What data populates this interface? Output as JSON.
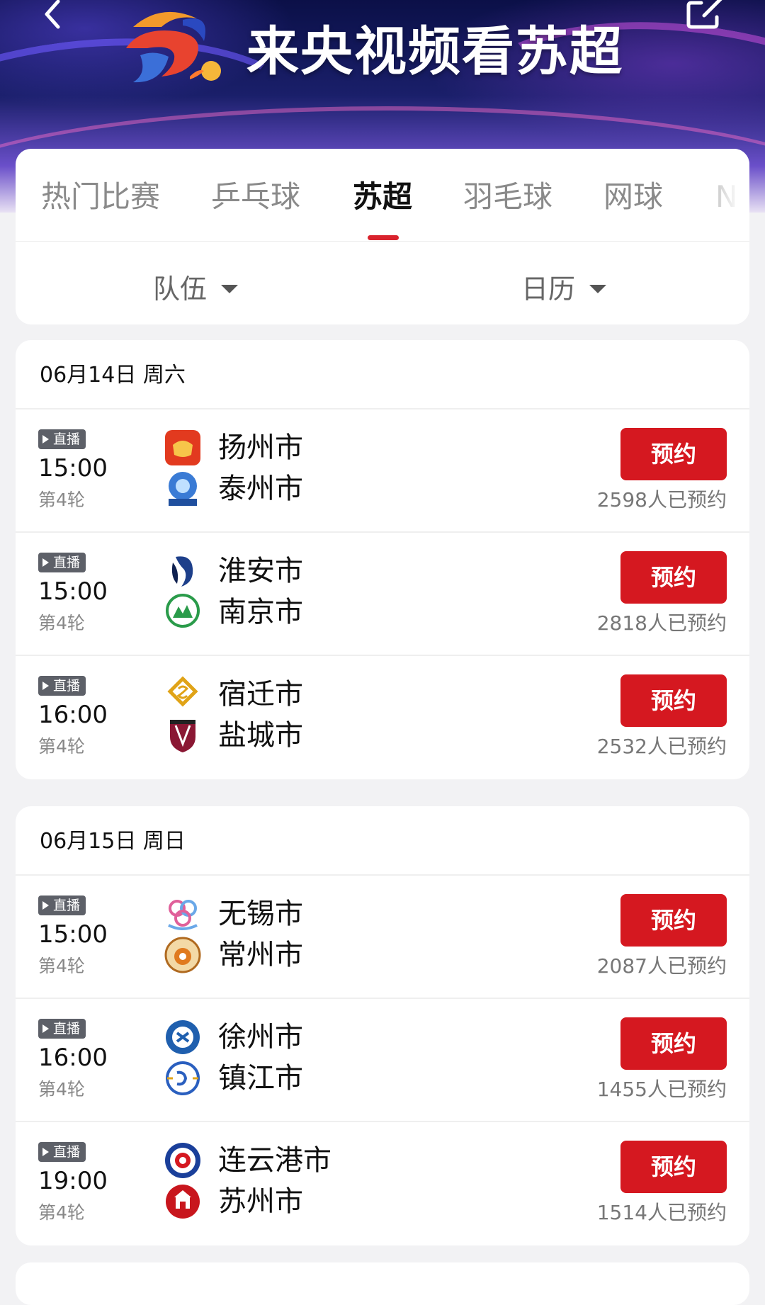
{
  "header": {
    "title": "来央视频看苏超",
    "back_icon": "chevron-left-icon",
    "share_icon": "share-icon"
  },
  "tabs": [
    {
      "label": "热门比赛",
      "active": false
    },
    {
      "label": "乒乓球",
      "active": false
    },
    {
      "label": "苏超",
      "active": true
    },
    {
      "label": "羽毛球",
      "active": false
    },
    {
      "label": "网球",
      "active": false
    },
    {
      "label": "N",
      "active": false
    }
  ],
  "filters": {
    "team": "队伍",
    "calendar": "日历"
  },
  "days": [
    {
      "date": "06月14日 周六",
      "matches": [
        {
          "badge": "直播",
          "time": "15:00",
          "round": "第4轮",
          "home": "扬州市",
          "away": "泰州市",
          "button": "预约",
          "count": "2598人已预约"
        },
        {
          "badge": "直播",
          "time": "15:00",
          "round": "第4轮",
          "home": "淮安市",
          "away": "南京市",
          "button": "预约",
          "count": "2818人已预约"
        },
        {
          "badge": "直播",
          "time": "16:00",
          "round": "第4轮",
          "home": "宿迁市",
          "away": "盐城市",
          "button": "预约",
          "count": "2532人已预约"
        }
      ]
    },
    {
      "date": "06月15日 周日",
      "matches": [
        {
          "badge": "直播",
          "time": "15:00",
          "round": "第4轮",
          "home": "无锡市",
          "away": "常州市",
          "button": "预约",
          "count": "2087人已预约"
        },
        {
          "badge": "直播",
          "time": "16:00",
          "round": "第4轮",
          "home": "徐州市",
          "away": "镇江市",
          "button": "预约",
          "count": "1455人已预约"
        },
        {
          "badge": "直播",
          "time": "19:00",
          "round": "第4轮",
          "home": "连云港市",
          "away": "苏州市",
          "button": "预约",
          "count": "1514人已预约"
        }
      ]
    }
  ],
  "colors": {
    "accent": "#d51820",
    "tab_indicator": "#d9232d",
    "banner_dark": "#0b1048"
  }
}
